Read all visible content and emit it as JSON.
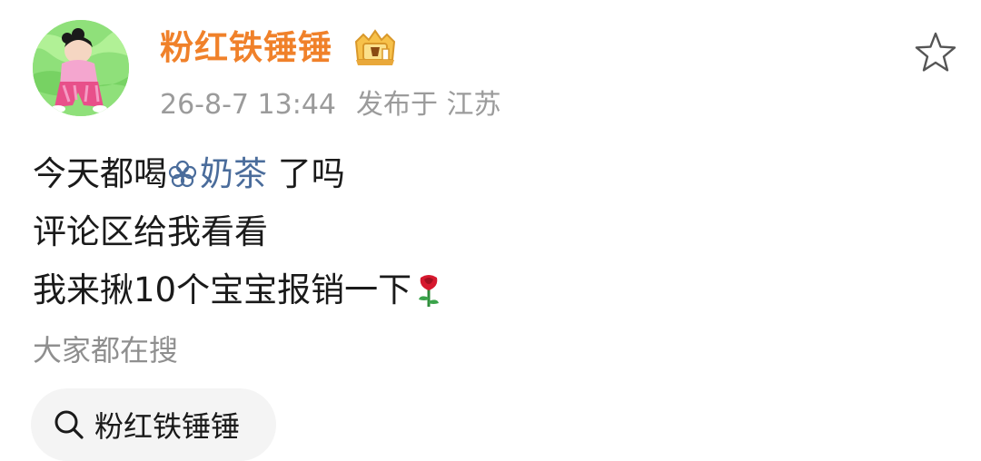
{
  "post": {
    "author": {
      "name": "粉红铁锤锤",
      "avatar": "avatar-illustration",
      "badge_icon": "crown-vip-icon",
      "name_color": "#f0812a"
    },
    "timestamp": "26-8-7 13:44",
    "location": "发布于 江苏",
    "favorite_icon": "star-outline-icon",
    "content": {
      "line1_prefix": "今天都喝",
      "topic": "奶茶",
      "topic_icon": "flower-topic-icon",
      "line1_suffix": " 了吗",
      "line2": "评论区给我看看",
      "line3": "我来揪10个宝宝报销一下",
      "emoji": "rose-icon"
    },
    "link_color": "#4a6c9b"
  },
  "search": {
    "heading": "大家都在搜",
    "chip_label": "粉红铁锤锤",
    "chip_icon": "search-icon"
  }
}
